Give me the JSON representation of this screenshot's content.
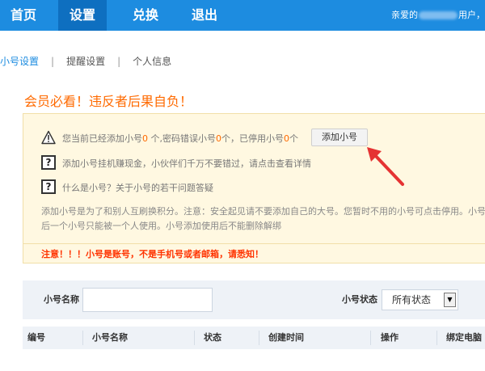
{
  "nav": {
    "items": [
      {
        "label": "首页",
        "active": false
      },
      {
        "label": "设置",
        "active": true
      },
      {
        "label": "兑换",
        "active": false
      },
      {
        "label": "退出",
        "active": false
      }
    ],
    "greeting_prefix": "亲爱的",
    "greeting_suffix": "用户，",
    "bg_color": "#1d8ce0"
  },
  "subtabs": {
    "items": [
      "小号设置",
      "提醒设置",
      "个人信息"
    ],
    "separator": "|",
    "active_index": 0
  },
  "warning_title": "会员必看！违反者后果自负！",
  "notice": {
    "status": {
      "part1": "您当前已经添加小号",
      "added_count": "0",
      "part2": " 个,密码错误小号",
      "wrong_count": "0",
      "part3": "个，已停用小号",
      "disabled_count": "0",
      "part4": "个"
    },
    "add_button": "添加小号",
    "line2": "添加小号挂机赚现金，小伙伴们千万不要错过，请点击查看详情",
    "line3": "什么是小号？关于小号的若干问题答疑",
    "desc": "添加小号是为了和别人互刷换积分。注意：安全起见请不要添加自己的大号。您暂时不用的小号可点击停用。小号添加后一个小号只能被一个人使用。小号添加使用后不能删除解绑",
    "footer": "注意！！！小号是账号，不是手机号或者邮箱，请悉知！",
    "question_icon_text": "?",
    "warning_icon": "warning-triangle-icon"
  },
  "filter": {
    "name_label": "小号名称",
    "name_value": "",
    "status_label": "小号状态",
    "status_value": "所有状态",
    "dropdown_glyph": "▼"
  },
  "table": {
    "headers": [
      "编号",
      "小号名称",
      "状态",
      "创建时间",
      "操作",
      "绑定电脑"
    ]
  },
  "colors": {
    "accent": "#1d8ce0",
    "warning": "#ff6a00",
    "alert": "#ff3300",
    "notice_bg": "#fff8e1",
    "arrow": "#e53333"
  }
}
